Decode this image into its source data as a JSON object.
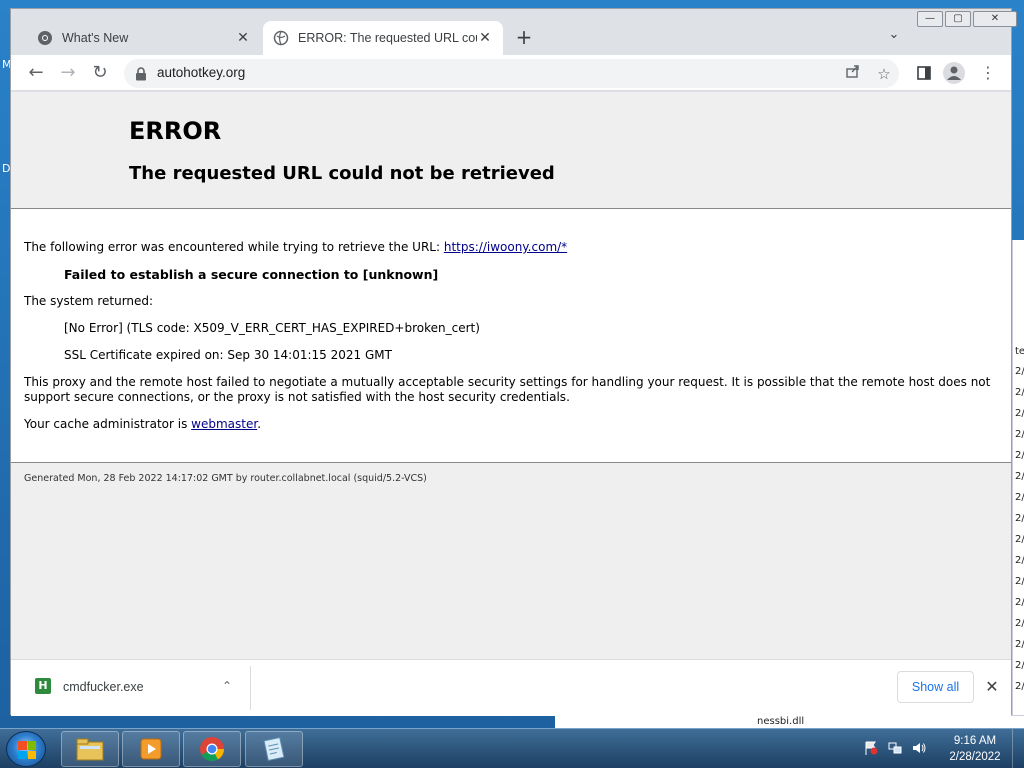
{
  "browser": {
    "tabs": [
      {
        "title": "What's New",
        "close": "✕"
      },
      {
        "title": "ERROR: The requested URL could not be retrieved",
        "close": "✕"
      }
    ],
    "new_tab": "+",
    "tab_search": "⌄",
    "window_controls": {
      "minimize": "—",
      "maximize": "▢",
      "close": "✕"
    },
    "address": "autohotkey.org",
    "nav": {
      "back": "←",
      "forward": "→",
      "reload": "↻"
    },
    "toolbar_icons": {
      "share": "share-icon",
      "bookmark": "☆",
      "side_panel": "side-panel-icon",
      "profile": "profile-icon",
      "menu": "⋮"
    }
  },
  "page": {
    "title": "ERROR",
    "subtitle": "The requested URL could not be retrieved",
    "intro": "The following error was encountered while trying to retrieve the URL: ",
    "intro_link": "https://iwoony.com/*",
    "failed": "Failed to establish a secure connection to [unknown]",
    "system_returned": "The system returned:",
    "tls": "[No Error] (TLS code: X509_V_ERR_CERT_HAS_EXPIRED+broken_cert)",
    "ssl_expired": "SSL Certificate expired on: Sep 30 14:01:15 2021 GMT",
    "proxy_line1": "This proxy and the remote host failed to negotiate a mutually acceptable security settings for handling your request. It is possible that the remote host does not",
    "proxy_line2": "support secure connections, or the proxy is not satisfied with the host security credentials.",
    "cache_admin": "Your cache administrator is ",
    "cache_admin_link": "webmaster",
    "cache_admin_end": ".",
    "footer": "Generated Mon, 28 Feb 2022 14:17:02 GMT by router.collabnet.local (squid/5.2-VCS)"
  },
  "downloads": {
    "file_icon_letter": "H",
    "file_name": "cmdfucker.exe",
    "chevron": "⌃",
    "show_all": "Show all",
    "close": "✕"
  },
  "taskbar": {
    "apps": [
      "explorer-icon",
      "media-player-icon",
      "chrome-icon",
      "notepad-icon"
    ],
    "time": "9:16 AM",
    "date": "2/28/2022"
  },
  "desktop": {
    "left_letters": [
      "M",
      "D"
    ],
    "explorer_rows": [
      "te",
      "2/",
      "2/",
      "2/",
      "2/",
      "2/",
      "2/",
      "2/",
      "2/",
      "2/",
      "2/",
      "2/",
      "2/",
      "2/",
      "2/",
      "2/",
      "2/"
    ],
    "explorer_bottom": "nessbi.dll"
  }
}
